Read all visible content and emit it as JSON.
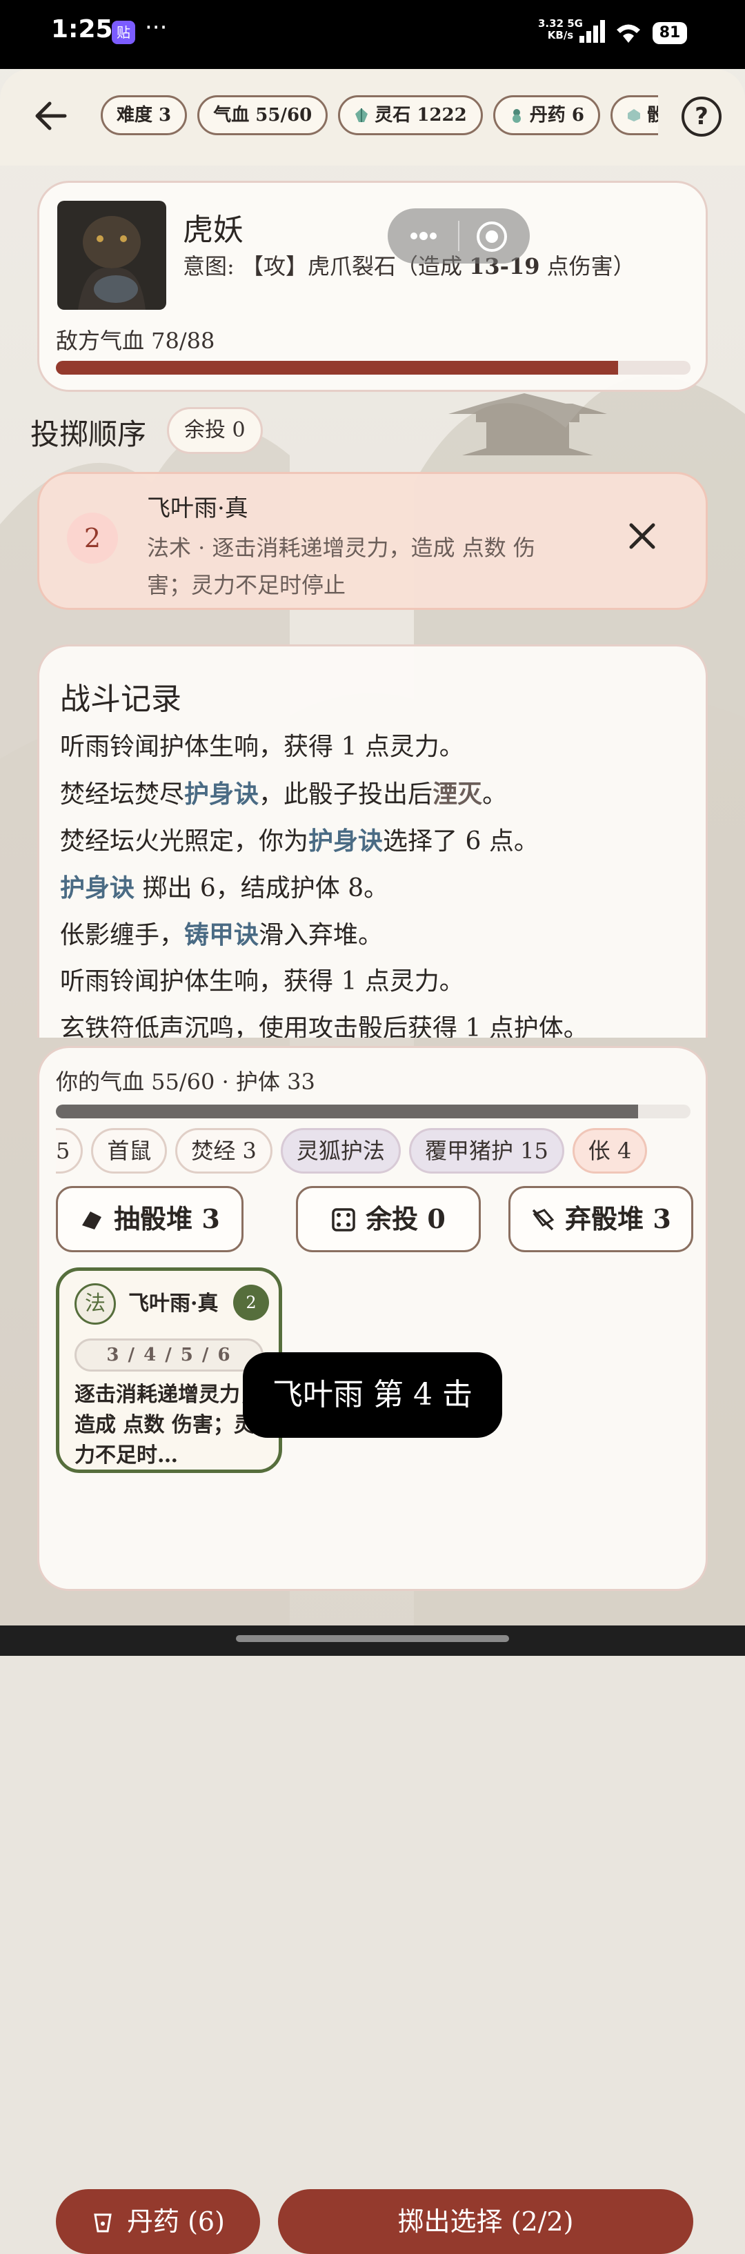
{
  "status_bar": {
    "time": "1:25",
    "app_badge": "贴",
    "dots": "···",
    "net_speed_value": "3.32",
    "net_speed_unit": "KB/s",
    "network": "5G",
    "battery": "81"
  },
  "header": {
    "stats": [
      {
        "label": "难度 3",
        "icon": ""
      },
      {
        "label": "气血 55/60",
        "icon": ""
      },
      {
        "label": "灵石 1222",
        "icon": "spirit-stone-icon"
      },
      {
        "label": "丹药 6",
        "icon": "potion-gourd-icon"
      },
      {
        "label": "骰",
        "icon": "dice-icon"
      }
    ],
    "help_label": "?"
  },
  "enemy": {
    "name": "虎妖",
    "intent_prefix": "意图: 【攻】虎爪裂石（造成 ",
    "intent_damage": "13-19",
    "intent_suffix": " 点伤害）",
    "hp_label": "敌方气血 78/88",
    "hp_fraction": 0.886
  },
  "roll_order": {
    "title": "投掷顺序",
    "remaining_label": "余投 0"
  },
  "queue": {
    "slot_number": "2",
    "name": "飞叶雨·真",
    "desc": "法术 · 逐击消耗递增灵力，造成 点数 伤害；灵力不足时停止"
  },
  "battle_log": {
    "title": "战斗记录",
    "lines": [
      {
        "a": "听雨铃闻护体生响，获得 1 点灵力。",
        "b": "",
        "c": "",
        "d": "",
        "e": ""
      },
      {
        "a": "焚经坛焚尽",
        "b": "护身诀",
        "c": "，此骰子投出后",
        "d": "湮灭",
        "e": "。"
      },
      {
        "a": "焚经坛火光照定，你为",
        "b": "护身诀",
        "c": "选择了 6 点。",
        "d": "",
        "e": ""
      },
      {
        "a": "",
        "b": "护身诀",
        "c": " 掷出 6，结成护体 8。",
        "d": "",
        "e": ""
      },
      {
        "a": "伥影缠手，",
        "b": "铸甲诀",
        "c": "滑入弃堆。",
        "d": "",
        "e": ""
      },
      {
        "a": "听雨铃闻护体生响，获得 1 点灵力。",
        "b": "",
        "c": "",
        "d": "",
        "e": ""
      },
      {
        "a": "玄铁符低声沉鸣，使用攻击骰后获得 1 点护体。",
        "b": "",
        "c": "",
        "d": "",
        "e": ""
      }
    ]
  },
  "player": {
    "hp_label": "你的气血 55/60 · 护体 33",
    "hp_fraction": 0.917,
    "buffs": [
      {
        "label": "5",
        "style": "cut"
      },
      {
        "label": "首鼠",
        "style": ""
      },
      {
        "label": "焚经 3",
        "style": ""
      },
      {
        "label": "灵狐护法",
        "style": "purple"
      },
      {
        "label": "覆甲猪护 15",
        "style": "purple"
      },
      {
        "label": "伥 4",
        "style": "pink"
      }
    ],
    "draw_pile_label": "抽骰堆 3",
    "reroll_label": "余投 0",
    "discard_label": "弃骰堆 3"
  },
  "die_card": {
    "type": "法",
    "name": "飞叶雨·真",
    "badge": "2",
    "faces": "3 / 4 / 5 / 6",
    "desc": "逐击消耗递增灵力，造成 点数 伤害；灵力不足时…"
  },
  "toast": "飞叶雨 第 4 击",
  "actions": {
    "potion_label": "丹药 (6)",
    "roll_label": "掷出选择 (2/2)"
  },
  "colors": {
    "accent": "#943a2d",
    "link": "#4a6b84",
    "die_green": "#566e3c"
  }
}
